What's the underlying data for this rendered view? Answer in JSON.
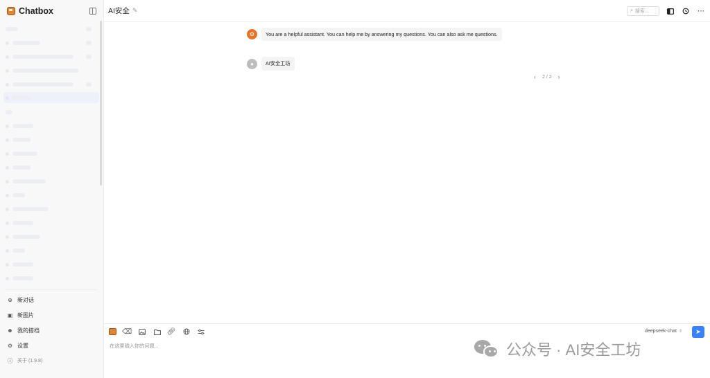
{
  "app": {
    "name": "Chatbox",
    "logo_color": "#d9883a"
  },
  "sidebar": {
    "bottom_items": [
      {
        "icon": "plus-circle-icon",
        "label": "新对话"
      },
      {
        "icon": "new-image-icon",
        "label": "新图片"
      },
      {
        "icon": "copilot-icon",
        "label": "我的搭档"
      },
      {
        "icon": "gear-icon",
        "label": "设置"
      },
      {
        "icon": "info-icon",
        "label": "关于 (1.9.8)"
      }
    ]
  },
  "header": {
    "title": "AI安全",
    "search_placeholder": "搜索..."
  },
  "messages": [
    {
      "role": "system",
      "text": "You are a helpful assistant. You can help me by answering my questions. You can also ask me questions."
    },
    {
      "role": "user",
      "text": "AI安全工坊"
    }
  ],
  "pager": {
    "text": "2 / 2"
  },
  "composer": {
    "model": "deepseek-chat",
    "placeholder": "在这里输入你的问题...",
    "value": "",
    "accent": "#3b82f6"
  },
  "watermark": {
    "text": "公众号 · AI安全工坊"
  }
}
